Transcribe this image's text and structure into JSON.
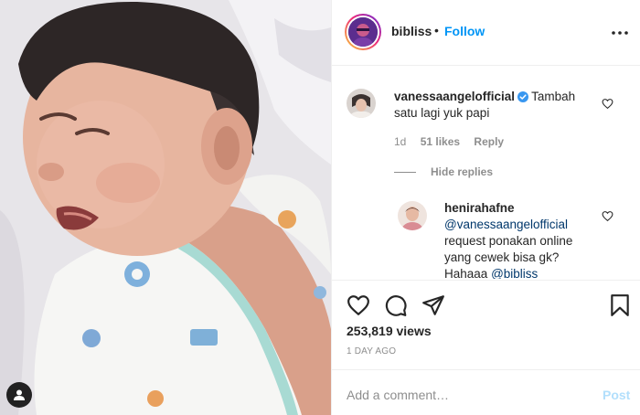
{
  "post": {
    "owner": "bibliss",
    "separator": "•",
    "follow_label": "Follow",
    "views": "253,819 views",
    "time_ago": "1 DAY AGO"
  },
  "comments": [
    {
      "username": "vanessaangelofficial",
      "verified": true,
      "text": "Tambah satu lagi yuk papi",
      "age": "1d",
      "likes": "51 likes",
      "reply_label": "Reply"
    }
  ],
  "hide_replies_label": "Hide replies",
  "replies": [
    {
      "username": "henirahafne",
      "mention": "@vanessaangelofficial",
      "text_line1": "request ponakan online",
      "text_line2": "yang cewek bisa gk?",
      "text_line3_prefix": "Hahaaa",
      "text_line3_mention": "@bibliss"
    }
  ],
  "composer": {
    "placeholder": "Add a comment…",
    "post_label": "Post"
  },
  "icons": {
    "more": "more-icon",
    "like": "heart-icon",
    "comment": "comment-icon",
    "share": "share-icon",
    "save": "bookmark-icon",
    "user_tag": "person-icon",
    "verified": "verified-badge-icon"
  },
  "colors": {
    "link_blue": "#0095f6",
    "mention_blue": "#00376b",
    "muted_text": "#8e8e8e",
    "post_disabled": "#b2dffc",
    "verified": "#3897f0"
  }
}
